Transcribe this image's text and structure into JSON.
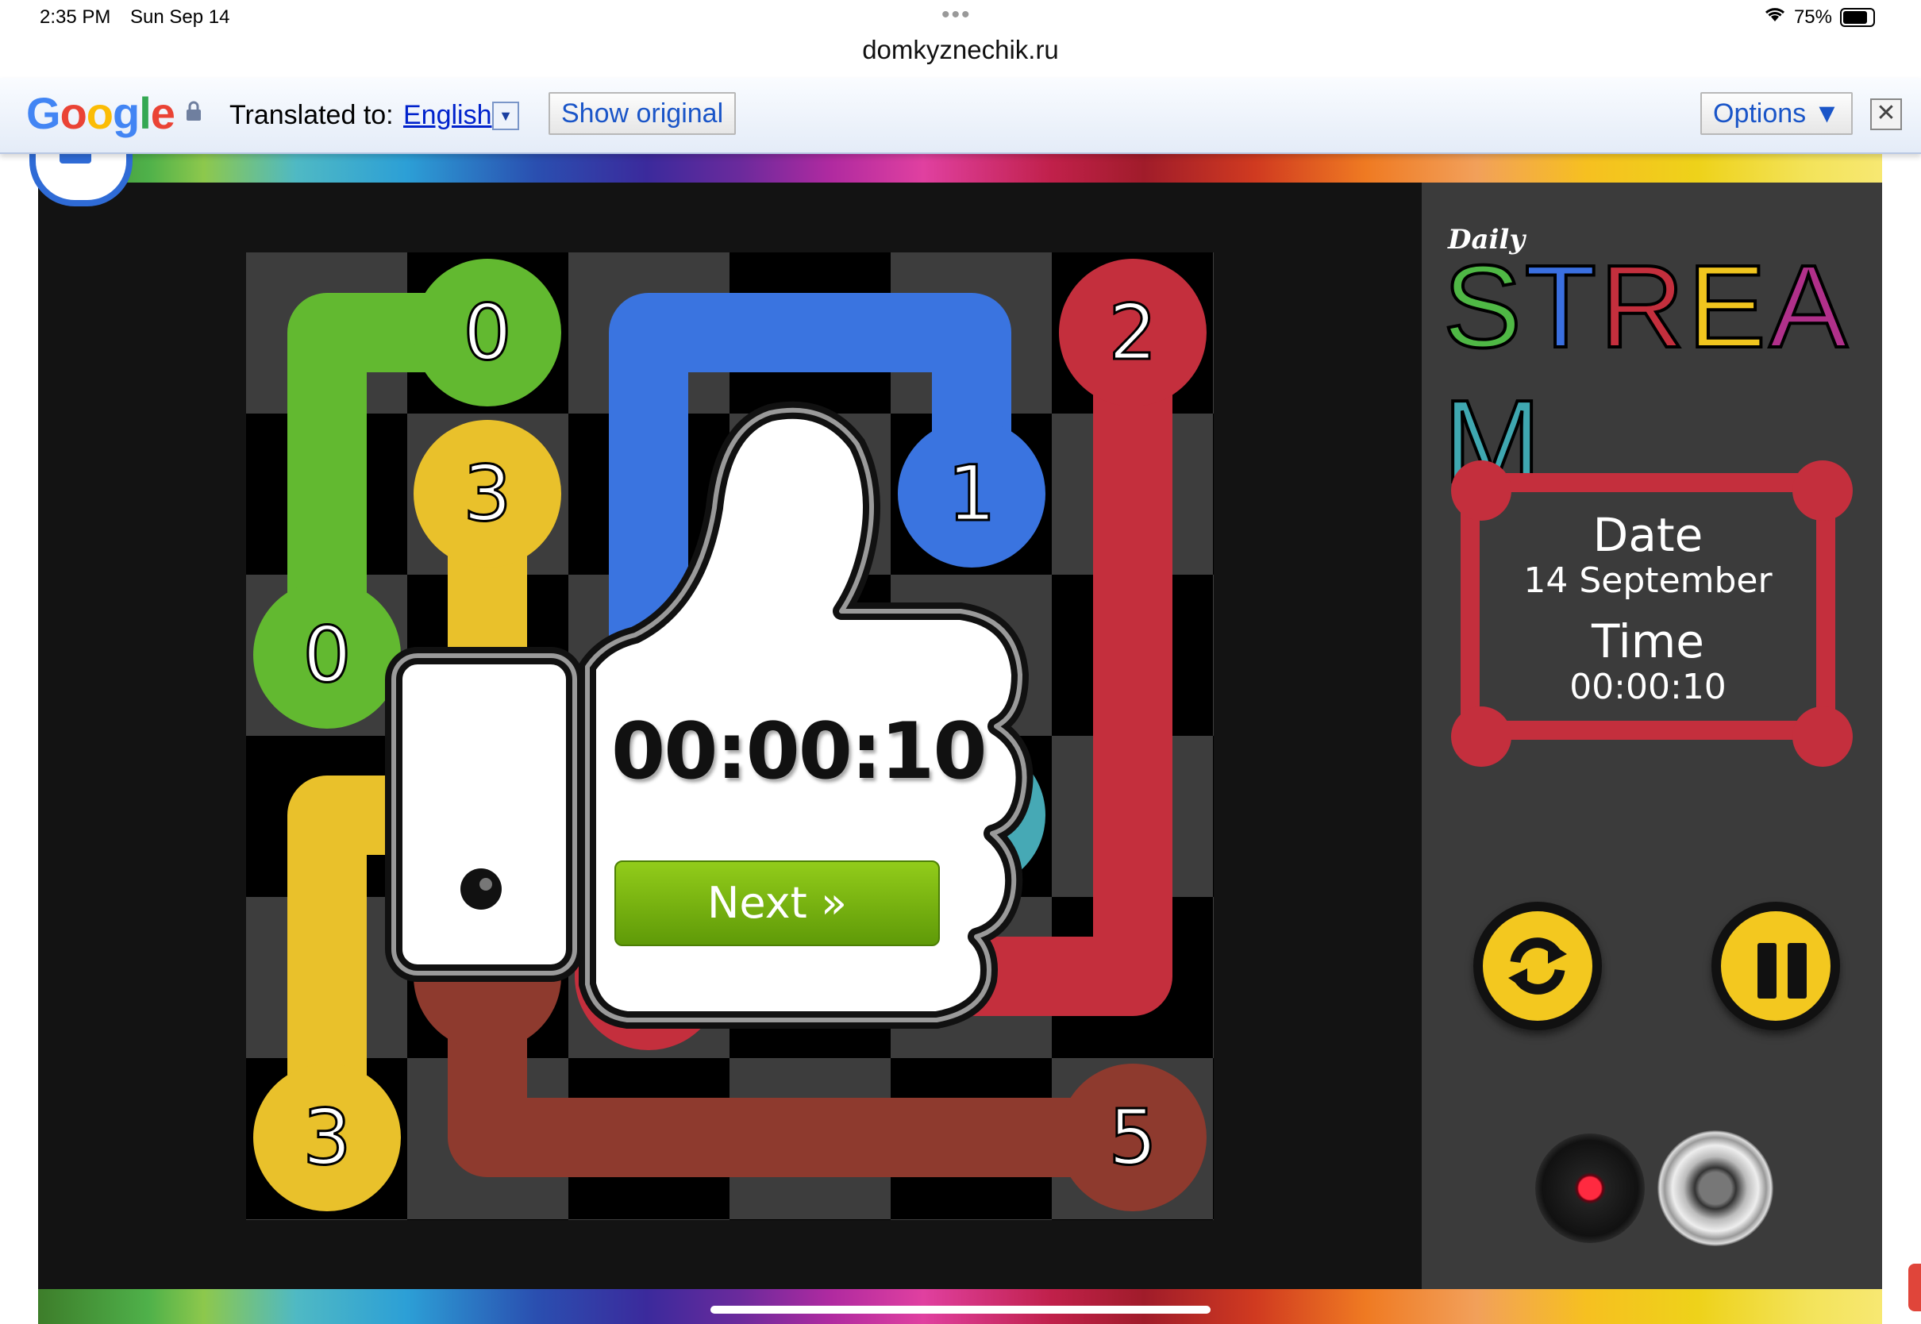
{
  "status_bar": {
    "time": "2:35 PM",
    "date": "Sun Sep 14",
    "url": "domkyznechik.ru",
    "battery": "75%"
  },
  "translate_bar": {
    "logo": "Google",
    "translated_to_label": "Translated to:",
    "language": "English",
    "show_original": "Show original",
    "options": "Options ▼"
  },
  "logo": {
    "daily": "Daily",
    "title_letters": [
      "S",
      "T",
      "R",
      "E",
      "A",
      "M"
    ],
    "letter_colors": [
      "#4fb845",
      "#3a6fe0",
      "#c42f3d",
      "#f0c51e",
      "#b0308a",
      "#3fa7b0"
    ]
  },
  "info": {
    "date_label": "Date",
    "date_value": "14 September",
    "time_label": "Time",
    "time_value": "00:00:10"
  },
  "controls": {
    "restart_icon": "restart-icon",
    "pause_icon": "pause-icon",
    "music_icon": "vinyl-music-icon",
    "sound_icon": "speaker-sound-icon"
  },
  "colors": {
    "green": "#62b930",
    "blue": "#3a74e0",
    "red": "#c42f3d",
    "yellow": "#e9c12b",
    "brown": "#8e3a2e",
    "teal": "#46a9b5"
  },
  "board": {
    "grid_size": 6,
    "labels": [
      "0",
      "0",
      "3",
      "1",
      "2",
      "3",
      "5"
    ]
  },
  "win_popup": {
    "time": "00:00:10",
    "next_label": "Next »"
  }
}
